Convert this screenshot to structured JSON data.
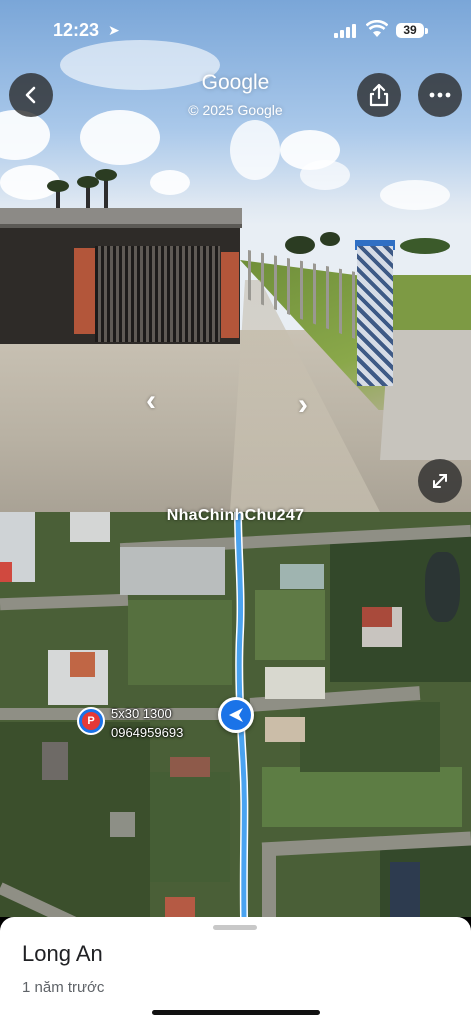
{
  "status_bar": {
    "time": "12:23",
    "battery": "39"
  },
  "streetview": {
    "title": "Google",
    "copyright": "© 2025 Google",
    "icons": [
      "back-icon",
      "share-icon",
      "more-icon",
      "expand-icon",
      "turn-left-arrow",
      "turn-right-arrow"
    ]
  },
  "map": {
    "watermark": "NhaChinhChu247",
    "pin_line1": "5x30 1300",
    "pin_line2": "0964959693",
    "route_color": "#4aa3f0",
    "accent": "#1a73e8"
  },
  "sheet": {
    "place_name": "Long An",
    "age": "1 năm trước"
  }
}
